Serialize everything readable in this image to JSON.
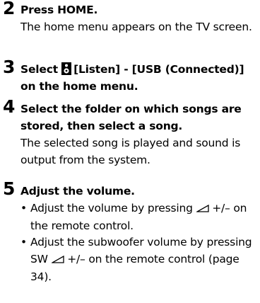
{
  "steps": [
    {
      "number": "2",
      "heading": "Press HOME.",
      "description": "The home menu appears on the TV screen."
    },
    {
      "number": "3",
      "heading_part1": "Select",
      "heading_part2": "[Listen] - [USB (Connected)] on the home menu."
    },
    {
      "number": "4",
      "heading": "Select the folder on which songs are stored, then select a song.",
      "description": "The selected song is played and sound is output from the system."
    },
    {
      "number": "5",
      "heading": "Adjust the volume.",
      "bullets": [
        {
          "part1": "Adjust the volume by pressing",
          "part2": "+/– on the remote control."
        },
        {
          "part1": "Adjust the subwoofer volume by pressing SW",
          "part2": "+/– on the remote control (page 34)."
        }
      ]
    }
  ],
  "icons": {
    "listen": "speaker-icon",
    "volume": "volume-wedge-icon"
  }
}
